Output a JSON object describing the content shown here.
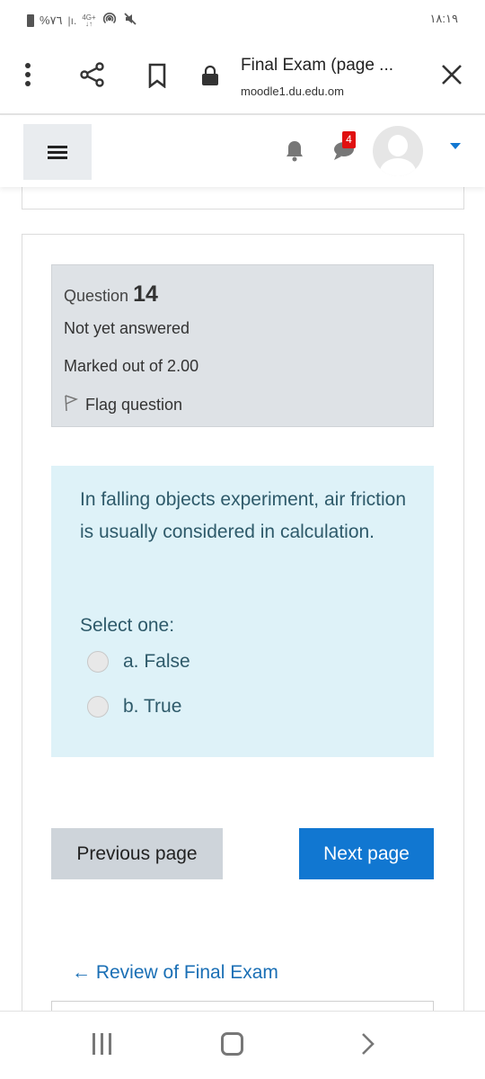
{
  "status_bar": {
    "battery": "%٧٦",
    "network": "4G+",
    "time": "١٨:١٩",
    "icons": [
      "battery-icon",
      "signal-icon",
      "network-4g-icon",
      "hotspot-icon",
      "mute-icon"
    ]
  },
  "browser": {
    "title": "Final Exam (page ...",
    "url": "moodle1.du.edu.om",
    "icons": [
      "more-vert-icon",
      "share-icon",
      "bookmark-icon",
      "lock-icon",
      "close-icon"
    ]
  },
  "moodle_nav": {
    "message_badge": "4",
    "colors": {
      "badge": "#e01010",
      "caret": "#1177d1"
    }
  },
  "question": {
    "label": "Question",
    "number": "14",
    "state": "Not yet answered",
    "marks": "Marked out of 2.00",
    "flag_label": "Flag question",
    "text": "In falling objects experiment, air friction is usually considered in calculation.",
    "prompt": "Select one:",
    "options": [
      {
        "label": "a. False",
        "selected": false
      },
      {
        "label": "b. True",
        "selected": false
      }
    ]
  },
  "navigation": {
    "previous_label": "Previous page",
    "next_label": "Next page",
    "review_link": "← Review of Final Exam",
    "colors": {
      "next_bg": "#1177d1",
      "prev_bg": "#ced4da",
      "link": "#1a6fb5"
    }
  }
}
